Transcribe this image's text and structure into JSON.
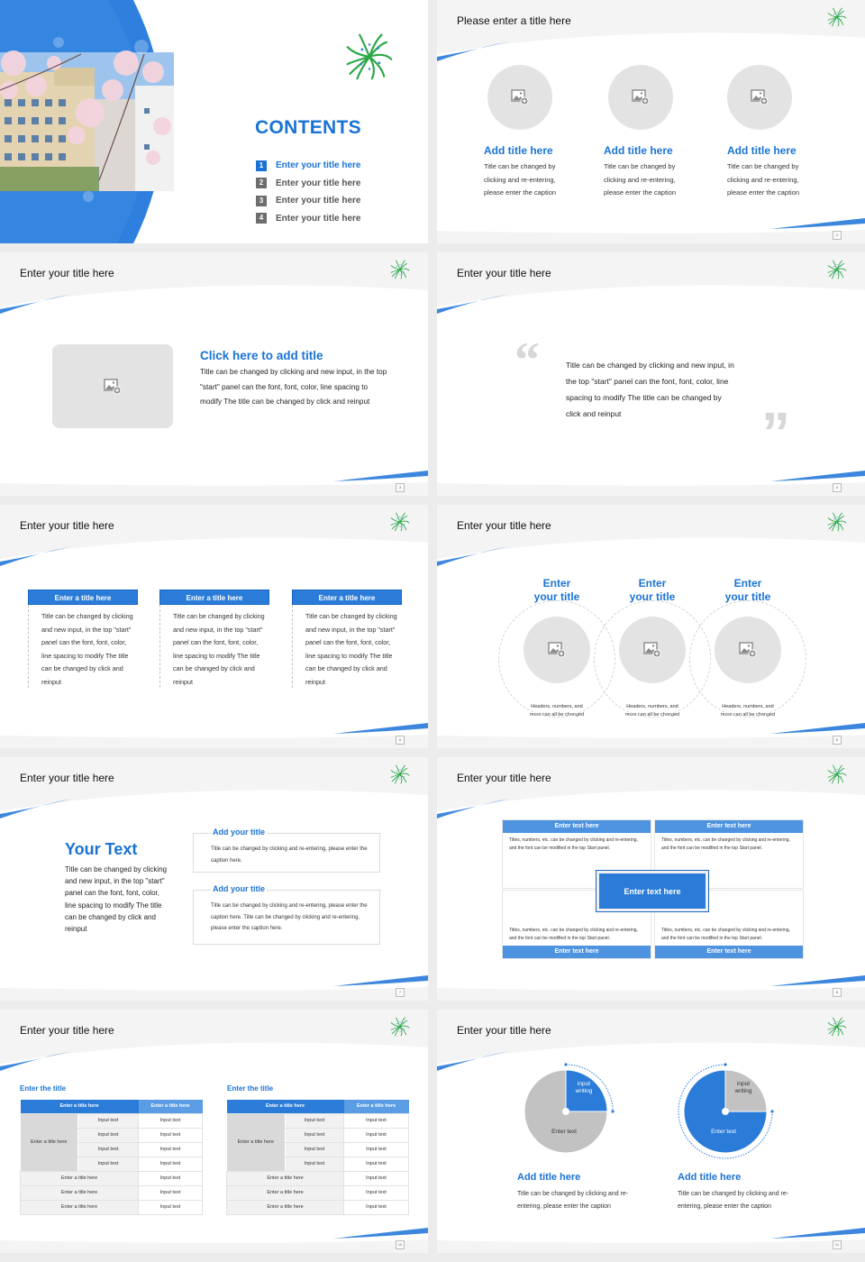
{
  "colors": {
    "accent": "#1a73d4",
    "header_fill": "#2b7cd9",
    "light_header": "#5a9de5",
    "placeholder_gray": "#e3e3e3",
    "logo_green": "#2aa845"
  },
  "slides": [
    {
      "id": 1,
      "heading": "CONTENTS",
      "toc": [
        {
          "num": "1",
          "label": "Enter your title here",
          "active": true
        },
        {
          "num": "2",
          "label": "Enter your title here"
        },
        {
          "num": "3",
          "label": "Enter your title here"
        },
        {
          "num": "4",
          "label": "Enter your title here"
        }
      ],
      "photo": "campus-building-with-cherry-blossoms"
    },
    {
      "id": 2,
      "title": "Please enter a title here",
      "page": "2",
      "items": [
        {
          "title": "Add title here",
          "caption": "Title can be changed by clicking and re-entering, please enter the caption",
          "icon": "image-add-icon"
        },
        {
          "title": "Add title here",
          "caption": "Title can be changed by clicking and re-entering, please enter the caption",
          "icon": "image-add-icon"
        },
        {
          "title": "Add title here",
          "caption": "Title can be changed by clicking and re-entering, please enter the caption",
          "icon": "image-add-icon"
        }
      ]
    },
    {
      "id": 3,
      "title": "Enter your title here",
      "page": "3",
      "heading": "Click here to add title",
      "text": "Title can be changed by clicking and new input, in the top \"start\" panel can the font, font, color, line spacing to modify The title can be changed by click and reinput"
    },
    {
      "id": 4,
      "title": "Enter your title here",
      "page": "4",
      "quote_open": "“",
      "quote_close": "”",
      "text": "Title can be changed by clicking and new input, in the top \"start\" panel can the font, font, color, line spacing to modify The title can be changed by click and reinput"
    },
    {
      "id": 5,
      "title": "Enter your title here",
      "page": "5",
      "columns": [
        {
          "head": "Enter a title here",
          "text": "Title can be changed by clicking and new input, in the top \"start\" panel can the font, font, color, line spacing to modify The title can be changed by click and reinput"
        },
        {
          "head": "Enter a title here",
          "text": "Title can be changed by clicking and new input, in the top \"start\" panel can the font, font, color, line spacing to modify The title can be changed by click and reinput"
        },
        {
          "head": "Enter a title here",
          "text": "Title can be changed by clicking and new input, in the top \"start\" panel can the font, font, color, line spacing to modify The title can be changed by click and reinput"
        }
      ]
    },
    {
      "id": 6,
      "title": "Enter your title here",
      "page": "6",
      "items": [
        {
          "title_l1": "Enter",
          "title_l2": "your title",
          "caption": "Headers, numbers, and more can all be changed"
        },
        {
          "title_l1": "Enter",
          "title_l2": "your title",
          "caption": "Headers, numbers, and more can all be changed"
        },
        {
          "title_l1": "Enter",
          "title_l2": "your title",
          "caption": "Headers, numbers, and more can all be changed"
        }
      ]
    },
    {
      "id": 7,
      "title": "Enter your title here",
      "page": "7",
      "heading": "Your Text",
      "text": "Title can be changed by clicking and new input, in the top \"start\" panel can the font, font, color, line spacing to modify The title can be changed by click and reinput",
      "boxes": [
        {
          "title": "Add your title",
          "text": "Title can be changed by clicking and re-entering, please enter the caption here."
        },
        {
          "title": "Add your title",
          "text": "Title can be changed by clicking and re-entering, please enter the caption here. Title can be changed by clicking and re-entering, please enter the caption here."
        }
      ]
    },
    {
      "id": 8,
      "title": "Enter your title here",
      "page": "8",
      "center": "Enter text here",
      "quads": [
        {
          "head": "Enter text here",
          "text": "Titles, numbers, etc. can be changed by clicking and re-entering, and the font can be modified in the top Start panel."
        },
        {
          "head": "Enter text here",
          "text": "Titles, numbers, etc. can be changed by clicking and re-entering, and the font can be modified in the top Start panel."
        },
        {
          "head": "Enter text here",
          "text": "Titles, numbers, etc. can be changed by clicking and re-entering, and the font can be modified in the top Start panel."
        },
        {
          "head": "Enter text here",
          "text": "Titles, numbers, etc. can be changed by clicking and re-entering, and the font can be modified in the top Start panel."
        }
      ]
    },
    {
      "id": 9,
      "title": "Enter your title here",
      "page": "10",
      "tables": [
        {
          "title": "Enter the title",
          "header": [
            "Enter a title here",
            "Enter a title here"
          ],
          "group_label": "Enter a title here",
          "group_rows": [
            [
              "Input text",
              "Input text"
            ],
            [
              "Input text",
              "Input text"
            ],
            [
              "Input text",
              "Input text"
            ],
            [
              "Input text",
              "Input text"
            ]
          ],
          "rows": [
            [
              "Enter a title here",
              "Input text"
            ],
            [
              "Enter a title here",
              "Input text"
            ],
            [
              "Enter a title here",
              "Input text"
            ]
          ]
        },
        {
          "title": "Enter the title",
          "header": [
            "Enter a title here",
            "Enter a title here"
          ],
          "group_label": "Enter a title here",
          "group_rows": [
            [
              "Input text",
              "Input text"
            ],
            [
              "Input text",
              "Input text"
            ],
            [
              "Input text",
              "Input text"
            ],
            [
              "Input text",
              "Input text"
            ]
          ],
          "rows": [
            [
              "Enter a title here",
              "Input text"
            ],
            [
              "Enter a title here",
              "Input text"
            ],
            [
              "Enter a title here",
              "Input text"
            ]
          ]
        }
      ]
    },
    {
      "id": 10,
      "title": "Enter your title here",
      "page": "11",
      "pies": [
        {
          "highlight_fraction": 0.25,
          "highlight": "input",
          "input_label_l1": "input",
          "input_label_l2": "writing",
          "main_label": "Enter text",
          "title": "Add title here",
          "caption": "Title can be changed by clicking and re-entering, please enter the caption"
        },
        {
          "highlight_fraction": 0.75,
          "highlight": "main",
          "input_label_l1": "input",
          "input_label_l2": "writing",
          "main_label": "Enter text",
          "title": "Add title here",
          "caption": "Title can be changed by clicking and re-entering, please enter the caption"
        }
      ]
    }
  ]
}
